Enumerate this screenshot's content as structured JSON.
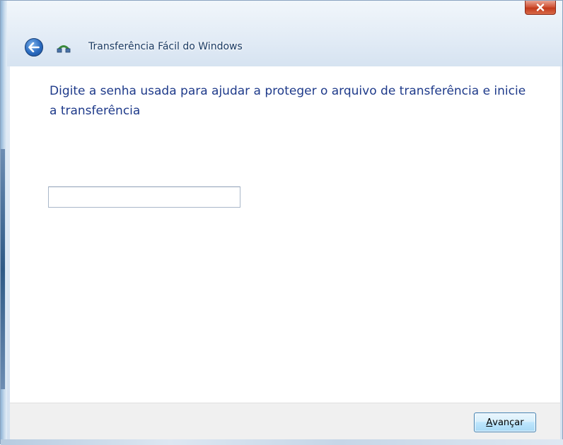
{
  "window": {
    "title": "Transferência Fácil do Windows",
    "close_label": "x"
  },
  "main": {
    "instruction": "Digite a senha usada para ajudar a proteger o arquivo de transferência e inicie a transferência",
    "password": {
      "value": "",
      "placeholder": ""
    }
  },
  "footer": {
    "next_mnemonic": "A",
    "next_rest": "vançar"
  },
  "icons": {
    "back": "back-arrow-icon",
    "app": "easy-transfer-icon",
    "close": "close-icon"
  },
  "colors": {
    "instruction_text": "#1e3a8a",
    "close_button": "#c23a1c",
    "accent_button": "#bee6fd"
  }
}
